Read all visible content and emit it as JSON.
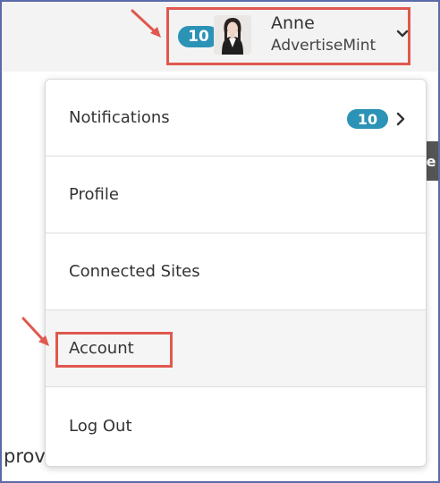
{
  "header": {
    "notification_count": "10",
    "user_name": "Anne",
    "user_org": "AdvertiseMint",
    "dropdown_icon": "chevron-down-icon"
  },
  "menu": {
    "items": [
      {
        "label": "Notifications",
        "badge": "10",
        "icon": "chevron-right-icon"
      },
      {
        "label": "Profile"
      },
      {
        "label": "Connected Sites"
      },
      {
        "label": "Account"
      },
      {
        "label": "Log Out"
      }
    ]
  },
  "background": {
    "partial_text": "prov",
    "side_tab_letter": "e"
  },
  "annotation_color": "#e0584f",
  "badge_color": "#2b93b6"
}
